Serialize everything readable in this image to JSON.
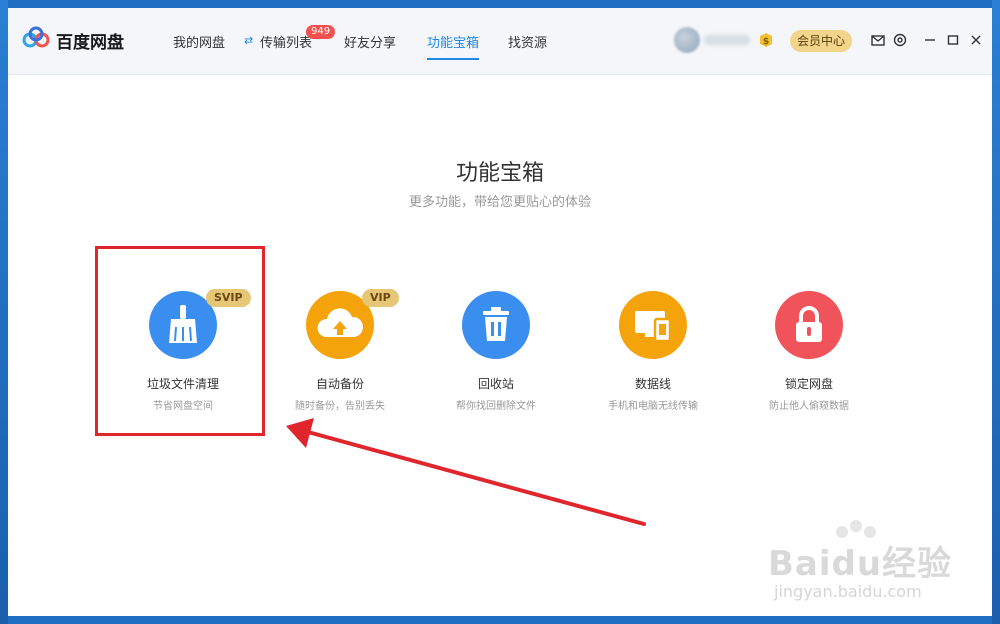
{
  "app": {
    "name": "百度网盘"
  },
  "nav": {
    "items": [
      "我的网盘",
      "传输列表",
      "好友分享",
      "功能宝箱",
      "找资源"
    ],
    "active": "功能宝箱",
    "transfer_badge": "949"
  },
  "topbar": {
    "vip_button": "会员中心"
  },
  "main": {
    "title": "功能宝箱",
    "subtitle": "更多功能，带给您更贴心的体验"
  },
  "tools": [
    {
      "name": "垃圾文件清理",
      "desc": "节省网盘空间",
      "badge": "SVIP",
      "icon": "broom-icon",
      "color": "#3a8ef0"
    },
    {
      "name": "自动备份",
      "desc": "随时备份，告别丢失",
      "badge": "VIP",
      "icon": "cloud-upload-icon",
      "color": "#f5a30a"
    },
    {
      "name": "回收站",
      "desc": "帮你找回删除文件",
      "badge": "",
      "icon": "trash-icon",
      "color": "#3a8ef0"
    },
    {
      "name": "数据线",
      "desc": "手机和电脑无线传输",
      "badge": "",
      "icon": "devices-icon",
      "color": "#f5a30a"
    },
    {
      "name": "锁定网盘",
      "desc": "防止他人偷窥数据",
      "badge": "",
      "icon": "lock-icon",
      "color": "#f0545a"
    }
  ],
  "watermark": {
    "text": "Baidu经验",
    "url": "jingyan.baidu.com"
  },
  "colors": {
    "accent": "#1e88e5",
    "vip_gold": "#e6c677",
    "annotation_red": "#e0262d"
  }
}
